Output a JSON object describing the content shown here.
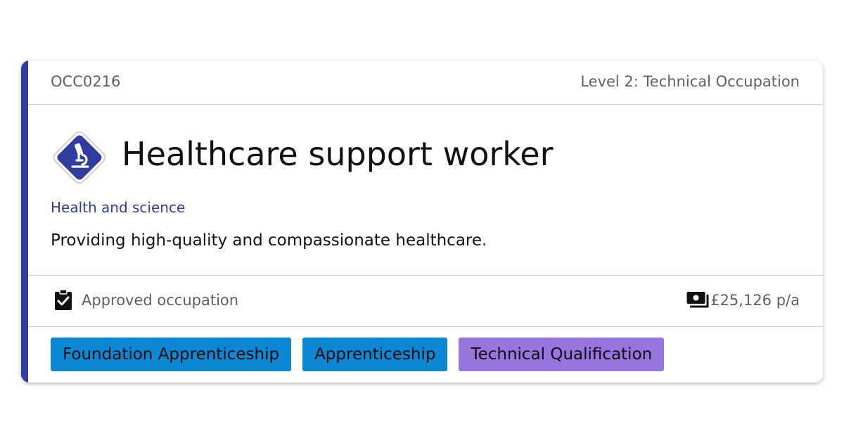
{
  "header": {
    "code": "OCC0216",
    "level": "Level 2: Technical Occupation"
  },
  "occupation": {
    "title": "Healthcare support worker",
    "route": "Health and science",
    "summary": "Providing high-quality and compassionate healthcare.",
    "route_icon": "microscope-icon"
  },
  "status": {
    "label": "Approved occupation",
    "icon": "clipboard-check-icon"
  },
  "salary": {
    "value": "£25,126 p/a",
    "icon": "money-icon"
  },
  "tags": [
    {
      "label": "Foundation Apprenticeship",
      "color": "#0b87d4"
    },
    {
      "label": "Apprenticeship",
      "color": "#0b87d4"
    },
    {
      "label": "Technical Qualification",
      "color": "#9775de"
    }
  ],
  "colors": {
    "accent": "#2f3d9e",
    "badge": "#2f3d9e",
    "text_muted": "#606060"
  }
}
